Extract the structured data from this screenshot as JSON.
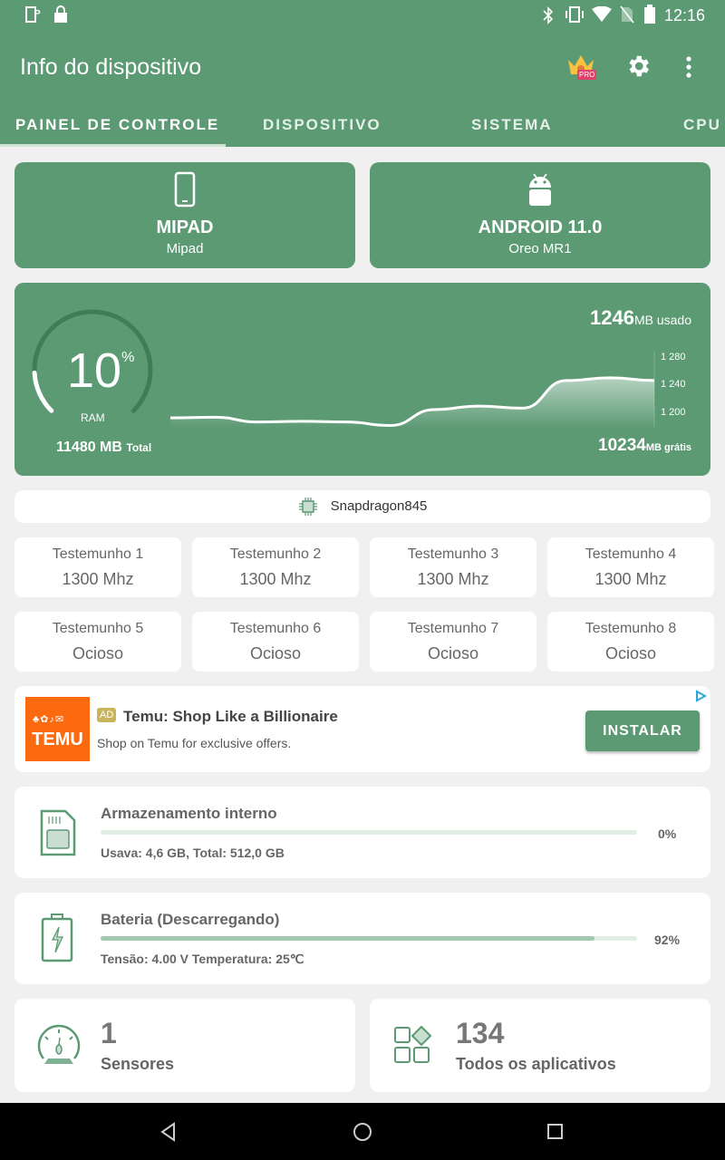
{
  "status": {
    "time": "12:16",
    "icons_left": [
      "screenshot-icon",
      "lock-icon"
    ],
    "icons_right": [
      "bluetooth-icon",
      "vibrate-icon",
      "wifi-icon",
      "no-sim-icon",
      "battery-icon"
    ]
  },
  "appbar": {
    "title": "Info do dispositivo",
    "actions": [
      "pro-crown-icon",
      "gear-icon",
      "more-vert-icon"
    ],
    "pro_badge": "PRO"
  },
  "tabs": [
    {
      "label": "PAINEL DE CONTROLE",
      "active": true
    },
    {
      "label": "DISPOSITIVO"
    },
    {
      "label": "SISTEMA"
    },
    {
      "label": "CPU"
    }
  ],
  "device": {
    "name": "MIPAD",
    "model": "Mipad"
  },
  "os": {
    "name": "ANDROID 11.0",
    "codename": "Oreo MR1"
  },
  "ram": {
    "percent": "10",
    "percent_sign": "%",
    "label": "RAM",
    "total": "11480 MB",
    "total_label": "Total",
    "used": "1246",
    "used_unit": "MB usado",
    "free": "10234",
    "free_unit": "MB grátis",
    "ticks": [
      "1 280",
      "1 240",
      "1 200"
    ],
    "history_mb": [
      1192,
      1193,
      1186,
      1187,
      1186,
      1181,
      1204,
      1209,
      1206,
      1246,
      1250,
      1246
    ],
    "usage_fraction": 0.1
  },
  "cpu": {
    "name": "Snapdragon845",
    "cores": [
      {
        "name": "Testemunho 1",
        "value": "1300 Mhz"
      },
      {
        "name": "Testemunho 2",
        "value": "1300 Mhz"
      },
      {
        "name": "Testemunho 3",
        "value": "1300 Mhz"
      },
      {
        "name": "Testemunho 4",
        "value": "1300 Mhz"
      },
      {
        "name": "Testemunho 5",
        "value": "Ocioso"
      },
      {
        "name": "Testemunho 6",
        "value": "Ocioso"
      },
      {
        "name": "Testemunho 7",
        "value": "Ocioso"
      },
      {
        "name": "Testemunho 8",
        "value": "Ocioso"
      }
    ]
  },
  "ad": {
    "badge": "AD",
    "title": "Temu: Shop Like a Billionaire",
    "subtitle": "Shop on Temu for exclusive offers.",
    "button": "INSTALAR",
    "logo_text": "TEMU",
    "logo_color": "#fb6a0f"
  },
  "storage": {
    "title": "Armazenamento interno",
    "detail": "Usava: 4,6 GB,  Total: 512,0 GB",
    "percent": "0%",
    "fraction": 0.0
  },
  "battery": {
    "title": "Bateria (Descarregando)",
    "detail": "Tensão: 4.00 V  Temperatura: 25℃",
    "percent": "92%",
    "fraction": 0.92
  },
  "sensors": {
    "count": "1",
    "label": "Sensores"
  },
  "apps": {
    "count": "134",
    "label": "Todos os aplicativos"
  },
  "colors": {
    "primary": "#5c9a74",
    "background": "#f0f0f0"
  }
}
